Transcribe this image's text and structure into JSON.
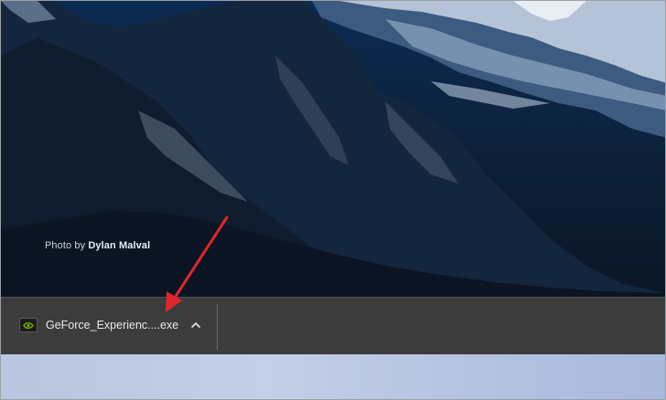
{
  "wallpaper": {
    "credit_prefix": "Photo by",
    "credit_author": "Dylan Malval"
  },
  "download_shelf": {
    "items": [
      {
        "file_name": "GeForce_Experienc....exe",
        "icon": "nvidia-icon",
        "menu_icon": "chevron-up-icon"
      }
    ]
  },
  "colors": {
    "shelf_background": "#3c3c3c",
    "annotation_arrow": "#e0262b",
    "nvidia_green": "#76b900"
  }
}
